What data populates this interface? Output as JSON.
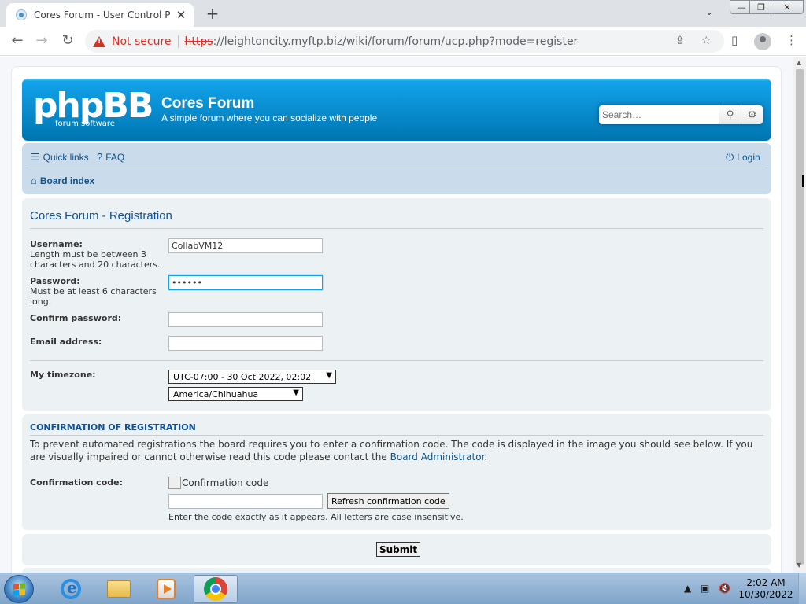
{
  "browser": {
    "tab_title": "Cores Forum - User Control Panel",
    "tab_close": "✕",
    "new_tab": "+",
    "tab_search": "⌄",
    "nav": {
      "back": "←",
      "forward": "→",
      "reload": "↻"
    },
    "security_label": "Not secure",
    "url_scheme": "https",
    "url_rest": "://leightoncity.myftp.biz/wiki/forum/forum/ucp.php?mode=register",
    "window_controls": {
      "minimize": "—",
      "maximize": "❐",
      "close": "✕"
    }
  },
  "header": {
    "logo_text": "phpBB",
    "logo_subtext": "forum   software",
    "site_title": "Cores Forum",
    "site_description": "A simple forum where you can socialize with people",
    "search_placeholder": "Search…"
  },
  "navbar": {
    "quick_links": "Quick links",
    "faq": "FAQ",
    "login": "Login",
    "board_index": "Board index"
  },
  "registration": {
    "title": "Cores Forum - Registration",
    "username": {
      "label": "Username:",
      "hint": "Length must be between 3 characters and 20 characters.",
      "value": "CollabVM12"
    },
    "password": {
      "label": "Password:",
      "hint": "Must be at least 6 characters long.",
      "value": "••••••"
    },
    "confirm_password": {
      "label": "Confirm password:",
      "value": ""
    },
    "email": {
      "label": "Email address:",
      "value": ""
    },
    "timezone": {
      "label": "My timezone:",
      "offset_selected": "UTC-07:00 - 30 Oct 2022, 02:02",
      "zone_selected": "America/Chihuahua"
    }
  },
  "confirmation": {
    "title": "Confirmation of registration",
    "text_before_link": "To prevent automated registrations the board requires you to enter a confirmation code. The code is displayed in the image you should see below. If you are visually impaired or cannot otherwise read this code please contact the ",
    "link_text": "Board Administrator",
    "text_after_link": ".",
    "code_label": "Confirmation code:",
    "image_alt": "Confirmation code",
    "code_value": "",
    "refresh_button": "Refresh confirmation code",
    "explain": "Enter the code exactly as it appears. All letters are case insensitive."
  },
  "form": {
    "submit": "Submit"
  },
  "taskbar": {
    "time": "2:02 AM",
    "date": "10/30/2022"
  }
}
